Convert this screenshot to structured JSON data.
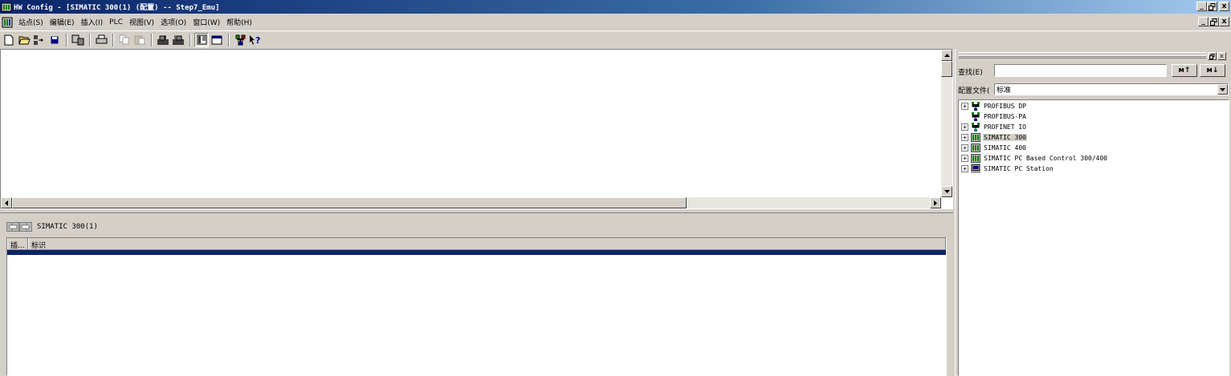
{
  "window": {
    "title": "HW Config - [SIMATIC 300(1) (配置) -- Step7_Emu]",
    "buttons": [
      "_",
      "🗗",
      "x"
    ]
  },
  "menu": {
    "items": [
      "站点(S)",
      "编辑(E)",
      "插入(I)",
      "PLC",
      "视图(V)",
      "选项(O)",
      "窗口(W)",
      "帮助(H)"
    ]
  },
  "toolbar": {
    "icons": [
      "new-icon",
      "open-icon",
      "save-compile-icon",
      "save-icon",
      "download-icon",
      "print-icon",
      "copy-icon",
      "paste-icon",
      "upload-icon",
      "download-module-icon",
      "catalog-icon",
      "window-icon",
      "network-icon",
      "help-icon"
    ]
  },
  "detail": {
    "station_name": "SIMATIC 300(1)",
    "columns": [
      "插...",
      "标识"
    ]
  },
  "catalog": {
    "search_label": "查找(E)",
    "search_value": "",
    "find_down_label": "ᴍ↑",
    "find_up_label": "ᴍ↓",
    "profile_label": "配置文件(",
    "profile_value": "标准",
    "tree": [
      {
        "label": "PROFIBUS DP",
        "expander": "+",
        "icon": "profibus-icon"
      },
      {
        "label": "PROFIBUS-PA",
        "expander": "",
        "icon": "profibus-icon"
      },
      {
        "label": "PROFINET IO",
        "expander": "+",
        "icon": "profinet-icon"
      },
      {
        "label": "SIMATIC 300",
        "expander": "+",
        "icon": "rack-icon",
        "selected": true
      },
      {
        "label": "SIMATIC 400",
        "expander": "+",
        "icon": "rack-icon"
      },
      {
        "label": "SIMATIC PC Based Control 300/400",
        "expander": "+",
        "icon": "rack-icon"
      },
      {
        "label": "SIMATIC PC Station",
        "expander": "+",
        "icon": "pc-station-icon"
      }
    ]
  },
  "colors": {
    "title_bar": "#0a246a",
    "face": "#d4d0c8",
    "selection": "#0a246a"
  }
}
